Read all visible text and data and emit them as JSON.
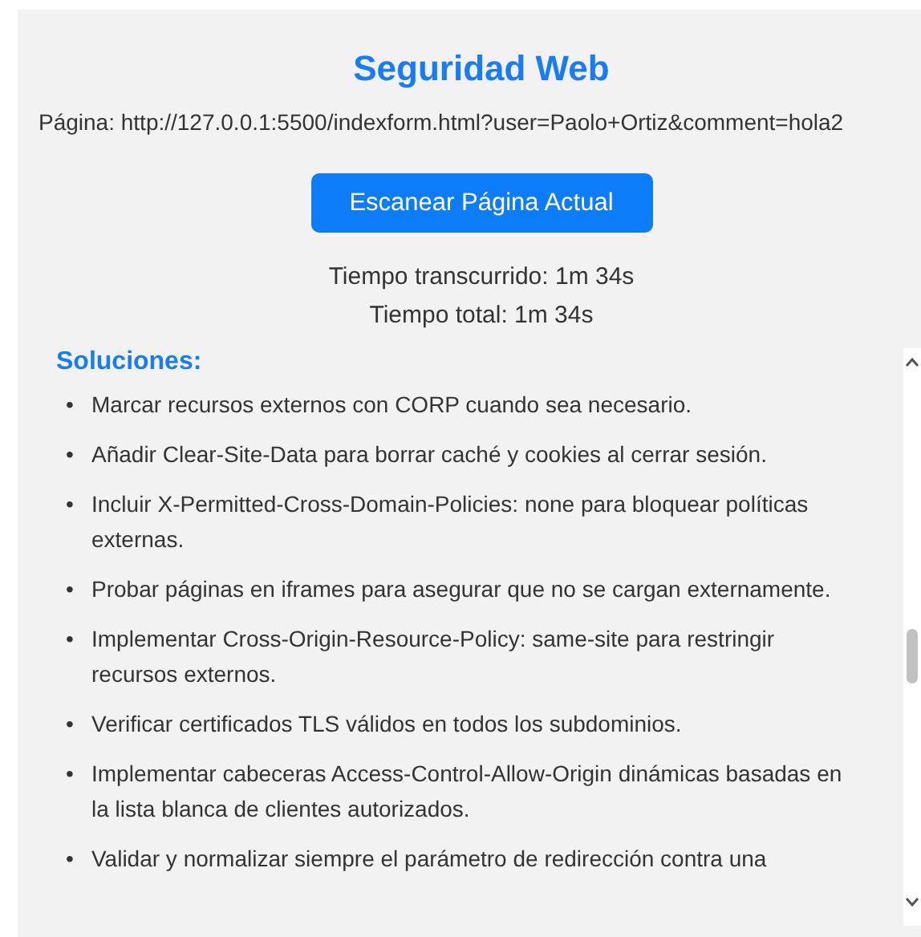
{
  "title": "Seguridad Web",
  "page_url": "Página: http://127.0.0.1:5500/indexform.html?user=Paolo+Ortiz&comment=hola2",
  "scan_button": "Escanear Página Actual",
  "elapsed_time": "Tiempo transcurrido: 1m 34s",
  "total_time": "Tiempo total: 1m 34s",
  "solutions": {
    "heading": "Soluciones:",
    "items": [
      {
        "bullet": "•",
        "text": "Marcar recursos externos con CORP cuando sea necesario."
      },
      {
        "bullet": "•",
        "text": "Añadir Clear-Site-Data para borrar caché y cookies al cerrar sesión."
      },
      {
        "bullet": "•",
        "text": "Incluir X-Permitted-Cross-Domain-Policies: none para bloquear políticas externas."
      },
      {
        "bullet": "•",
        "text": "Probar páginas en iframes para asegurar que no se cargan externamente."
      },
      {
        "bullet": "•",
        "text": "Implementar Cross-Origin-Resource-Policy: same-site para restringir recursos externos."
      },
      {
        "bullet": "•",
        "text": "Verificar certificados TLS válidos en todos los subdominios."
      },
      {
        "bullet": "•",
        "text": "Implementar cabeceras Access-Control-Allow-Origin dinámicas basadas en la lista blanca de clientes autorizados."
      },
      {
        "bullet": "•",
        "text": "Validar y normalizar siempre el parámetro de redirección contra una"
      }
    ]
  }
}
